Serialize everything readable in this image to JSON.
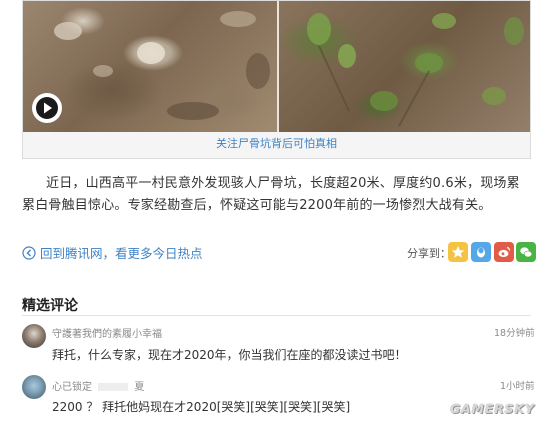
{
  "video": {
    "caption": "关注尸骨坑背后可怕真相"
  },
  "article": {
    "body": "近日，山西高平一村民意外发现骇人尸骨坑，长度超20米、厚度约0.6米，现场累累白骨触目惊心。专家经勘查后，怀疑这可能与2200年前的一场惨烈大战有关。"
  },
  "links": {
    "back": "回到腾讯网，看更多今日热点"
  },
  "share": {
    "label": "分享到：",
    "icons": [
      "star-icon",
      "qq-icon",
      "weibo-icon",
      "wechat-icon"
    ],
    "colors": {
      "qzone": "#f5c344",
      "qq": "#55a7e8",
      "weibo": "#e25b47",
      "wechat": "#49b443"
    }
  },
  "comments_section": {
    "title": "精选评论",
    "comments": [
      {
        "user": "守護著我們的素履小幸福",
        "time": "18分钟前",
        "text": "拜托，什么专家，现在才2020年，你当我们在座的都没读过书吧！"
      },
      {
        "user": "心已锁定",
        "user_suffix": "夏",
        "time": "1小时前",
        "text": "2200 ？ 拜托他妈现在才2020[哭笑][哭笑][哭笑][哭笑]"
      }
    ]
  },
  "watermark": "GAMERSKY",
  "accent_color": "#3d83c6"
}
